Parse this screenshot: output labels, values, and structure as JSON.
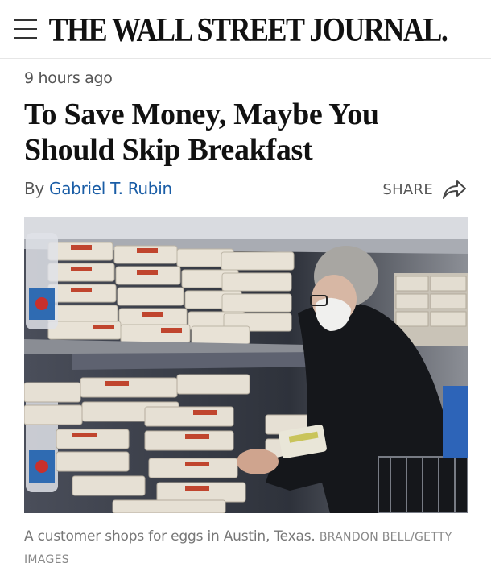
{
  "header": {
    "masthead": "THE WALL STREET JOURNAL.",
    "menu_icon": "hamburger-menu-icon"
  },
  "article": {
    "timestamp": "9 hours ago",
    "headline": "To Save Money, Maybe You Should Skip Breakfast",
    "byline_prefix": "By",
    "author": "Gabriel T. Rubin",
    "share_label": "SHARE",
    "share_icon": "share-arrow-icon"
  },
  "photo": {
    "caption": "A customer shops for eggs in Austin, Texas.",
    "credit": "BRANDON BELL/GETTY IMAGES"
  },
  "colors": {
    "link": "#1a5da6",
    "text": "#111111",
    "muted": "#555555"
  }
}
